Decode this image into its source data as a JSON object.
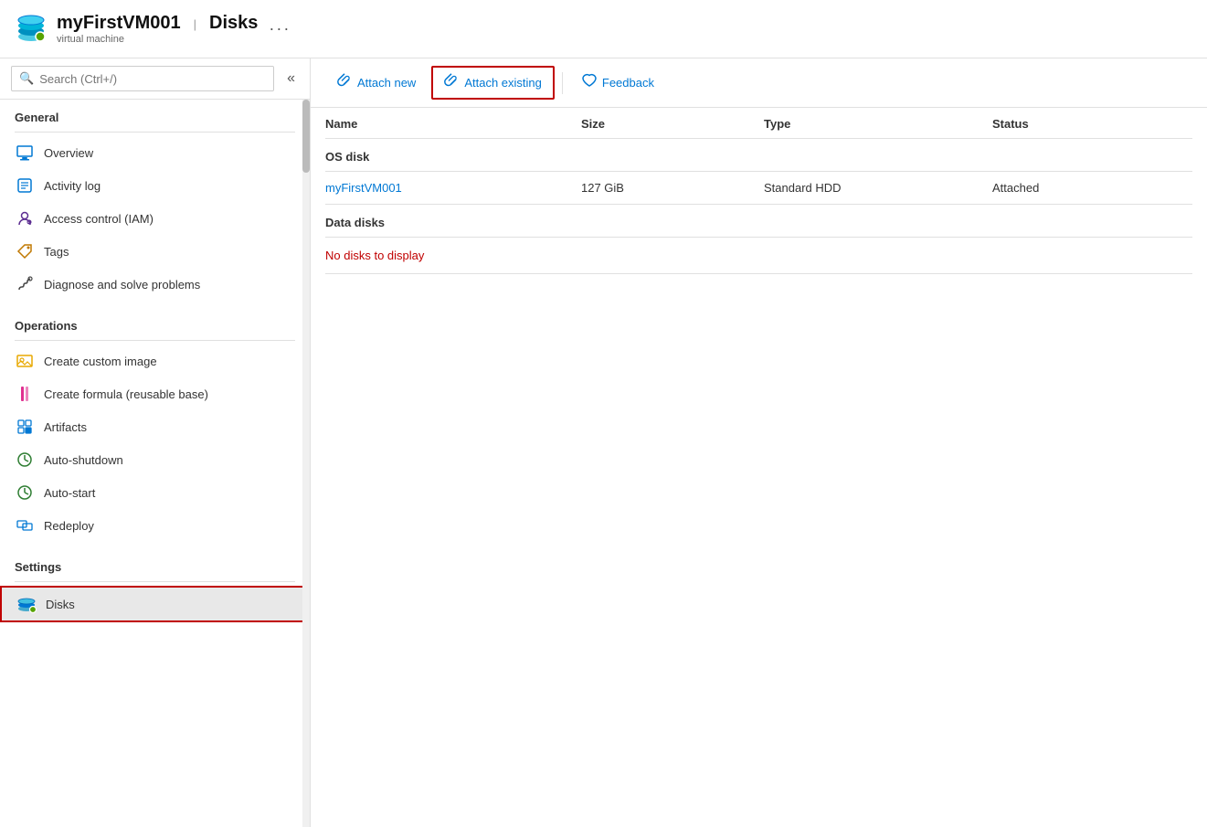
{
  "header": {
    "title": "myFirstVM001",
    "separator": "|",
    "page": "Disks",
    "more": "···",
    "subtitle": "virtual machine"
  },
  "sidebar": {
    "search_placeholder": "Search (Ctrl+/)",
    "collapse_icon": "«",
    "sections": [
      {
        "title": "General",
        "items": [
          {
            "id": "overview",
            "label": "Overview",
            "icon": "monitor"
          },
          {
            "id": "activity-log",
            "label": "Activity log",
            "icon": "list"
          },
          {
            "id": "iam",
            "label": "Access control (IAM)",
            "icon": "person"
          },
          {
            "id": "tags",
            "label": "Tags",
            "icon": "tag"
          },
          {
            "id": "diagnose",
            "label": "Diagnose and solve problems",
            "icon": "wrench"
          }
        ]
      },
      {
        "title": "Operations",
        "items": [
          {
            "id": "custom-image",
            "label": "Create custom image",
            "icon": "image"
          },
          {
            "id": "formula",
            "label": "Create formula (reusable base)",
            "icon": "formula"
          },
          {
            "id": "artifacts",
            "label": "Artifacts",
            "icon": "artifacts"
          },
          {
            "id": "autoshutdown",
            "label": "Auto-shutdown",
            "icon": "clock"
          },
          {
            "id": "autostart",
            "label": "Auto-start",
            "icon": "clock"
          },
          {
            "id": "redeploy",
            "label": "Redeploy",
            "icon": "redeploy"
          }
        ]
      },
      {
        "title": "Settings",
        "items": [
          {
            "id": "disks",
            "label": "Disks",
            "icon": "disk",
            "active": true
          }
        ]
      }
    ]
  },
  "toolbar": {
    "attach_new_label": "Attach new",
    "attach_existing_label": "Attach existing",
    "feedback_label": "Feedback"
  },
  "table": {
    "columns": [
      "Name",
      "Size",
      "Type",
      "Status"
    ],
    "os_disk_header": "OS disk",
    "os_disk_row": {
      "name": "myFirstVM001",
      "size": "127 GiB",
      "type": "Standard HDD",
      "status": "Attached"
    },
    "data_disks_header": "Data disks",
    "no_data_message": "No disks to display"
  }
}
